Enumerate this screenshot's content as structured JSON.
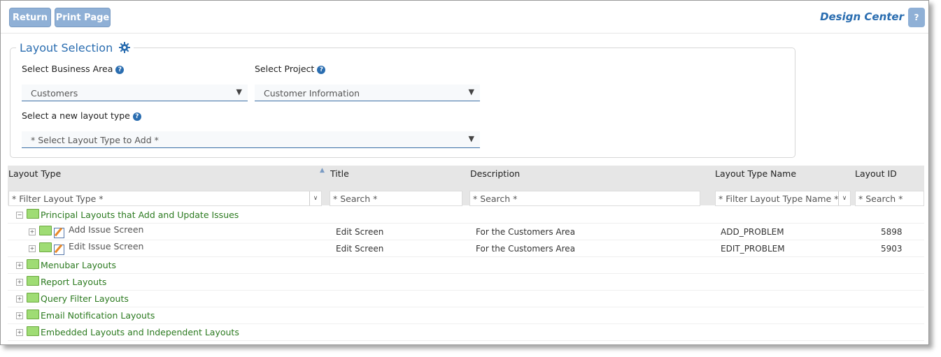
{
  "toolbar": {
    "return_label": "Return",
    "print_label": "Print Page",
    "app_title": "Design Center",
    "help_label": "?"
  },
  "selection": {
    "legend": "Layout Selection",
    "business_area_label": "Select Business Area",
    "business_area_value": "Customers",
    "project_label": "Select Project",
    "project_value": "Customer Information",
    "layout_type_label": "Select a new layout type",
    "layout_type_value": "* Select Layout Type to Add *"
  },
  "grid": {
    "columns": [
      "Layout Type",
      "Title",
      "Description",
      "Layout Type Name",
      "Layout ID"
    ],
    "filters": [
      "* Filter Layout Type *",
      "* Search *",
      "* Search *",
      "* Filter Layout Type Name *",
      "* Search *"
    ],
    "groups": [
      {
        "label": "Principal Layouts that Add and Update Issues",
        "expanded": true,
        "children": [
          {
            "name": "Add Issue Screen",
            "title": "Edit Screen",
            "description": "For the Customers Area",
            "type_name": "ADD_PROBLEM",
            "id": "5898"
          },
          {
            "name": "Edit Issue Screen",
            "title": "Edit Screen",
            "description": "For the Customers Area",
            "type_name": "EDIT_PROBLEM",
            "id": "5903"
          }
        ]
      },
      {
        "label": "Menubar Layouts"
      },
      {
        "label": "Report Layouts"
      },
      {
        "label": "Query Filter Layouts"
      },
      {
        "label": "Email Notification Layouts"
      },
      {
        "label": "Embedded Layouts and Independent Layouts"
      }
    ]
  },
  "icons": {
    "gear": "gear-icon",
    "help": "help-icon",
    "folder": "folder-icon",
    "edit": "edit-layout-icon",
    "sort": "sort-asc-icon"
  },
  "colors": {
    "accent": "#2a6db0",
    "button": "#8fb0d6",
    "tree_text": "#2b7a1f"
  }
}
